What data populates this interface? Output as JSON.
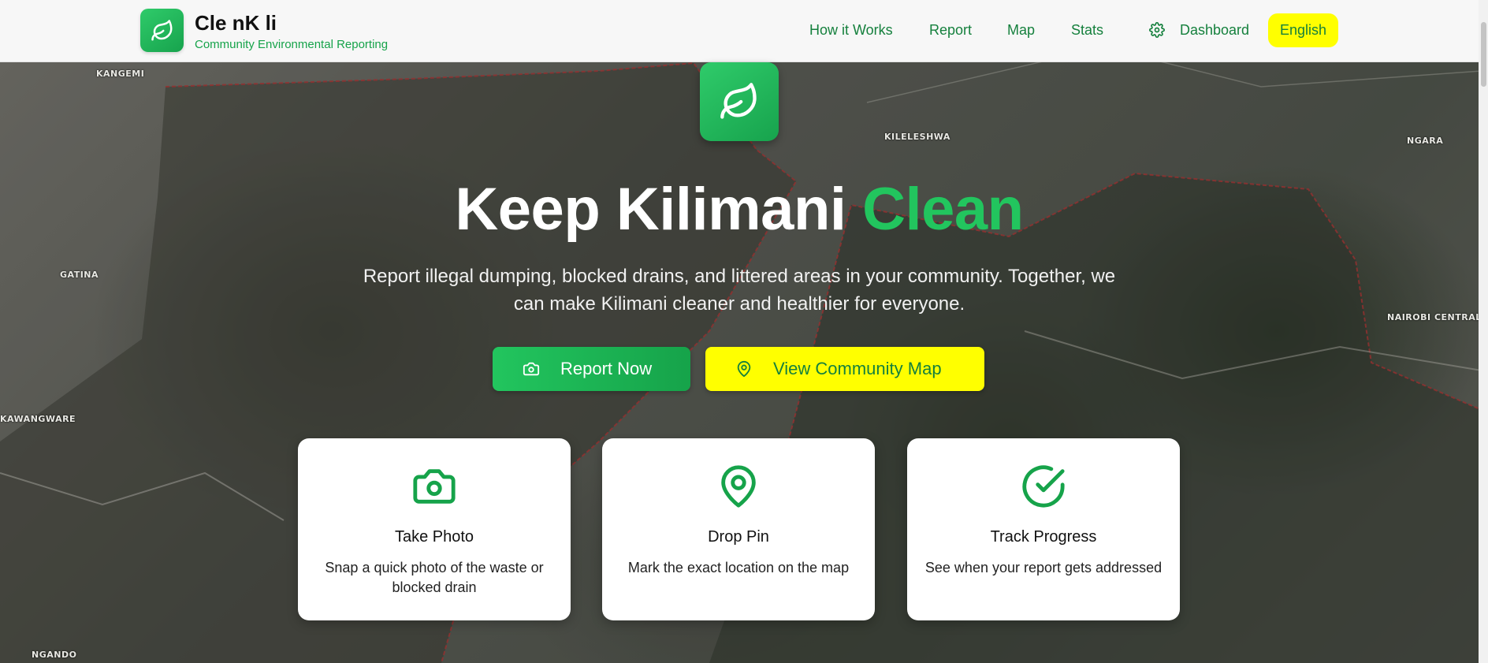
{
  "brand": {
    "name": "Cle nK li",
    "tagline": "Community Environmental Reporting",
    "icon": "leaf-icon",
    "accent": "#16a34a"
  },
  "nav": {
    "links": [
      {
        "label": "How it Works"
      },
      {
        "label": "Report"
      },
      {
        "label": "Map"
      },
      {
        "label": "Stats"
      }
    ],
    "dashboard_label": "Dashboard",
    "dashboard_icon": "gear-icon",
    "language_label": "English"
  },
  "map_labels": [
    "KANGEMI",
    "KILELESHWA",
    "NGARA",
    "GATINA",
    "NAIROBI CENTRAL",
    "KAWANGWARE",
    "NGANDO"
  ],
  "hero": {
    "title_main": "Keep Kilimani",
    "title_accent": "Clean",
    "subtitle": "Report illegal dumping, blocked drains, and littered areas in your community. Together, we can make Kilimani cleaner and healthier for everyone.",
    "primary_button": "Report Now",
    "secondary_button": "View Community Map"
  },
  "features": [
    {
      "title": "Take Photo",
      "description": "Snap a quick photo of the waste or blocked drain",
      "icon": "camera-icon"
    },
    {
      "title": "Drop Pin",
      "description": "Mark the exact location on the map",
      "icon": "map-pin-icon"
    },
    {
      "title": "Track Progress",
      "description": "See when your report gets addressed",
      "icon": "check-circle-icon"
    }
  ],
  "colors": {
    "green": "#22c55e",
    "dark_green": "#15803d",
    "yellow": "#ffff00"
  }
}
